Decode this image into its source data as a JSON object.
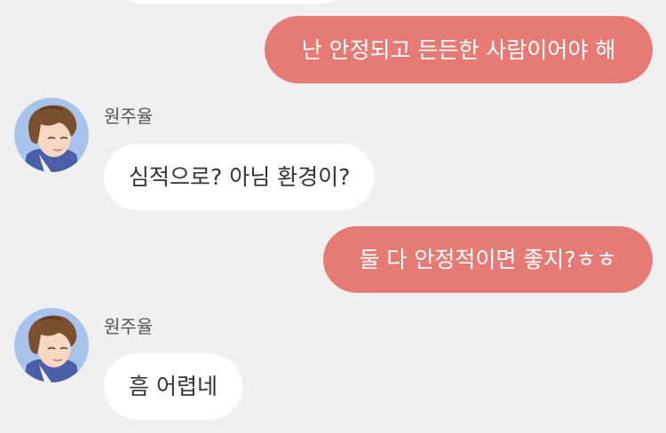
{
  "messages": [
    {
      "id": "m1",
      "side": "sent",
      "text": "난 안정되고 든든한 사람이어야 해"
    },
    {
      "id": "m2",
      "side": "received",
      "sender": "원주율",
      "text": "심적으로? 아님 환경이?"
    },
    {
      "id": "m3",
      "side": "sent",
      "text": "둘 다 안정적이면 좋지?ㅎㅎ"
    },
    {
      "id": "m4",
      "side": "received",
      "sender": "원주율",
      "text": "흠 어렵네"
    }
  ],
  "colors": {
    "background": "#f0f0f0",
    "sent_bubble": "#e57b74",
    "received_bubble": "#ffffff",
    "avatar_background": "#a8c4ec"
  },
  "icons": {
    "avatar": "cartoon-boy-avatar"
  }
}
